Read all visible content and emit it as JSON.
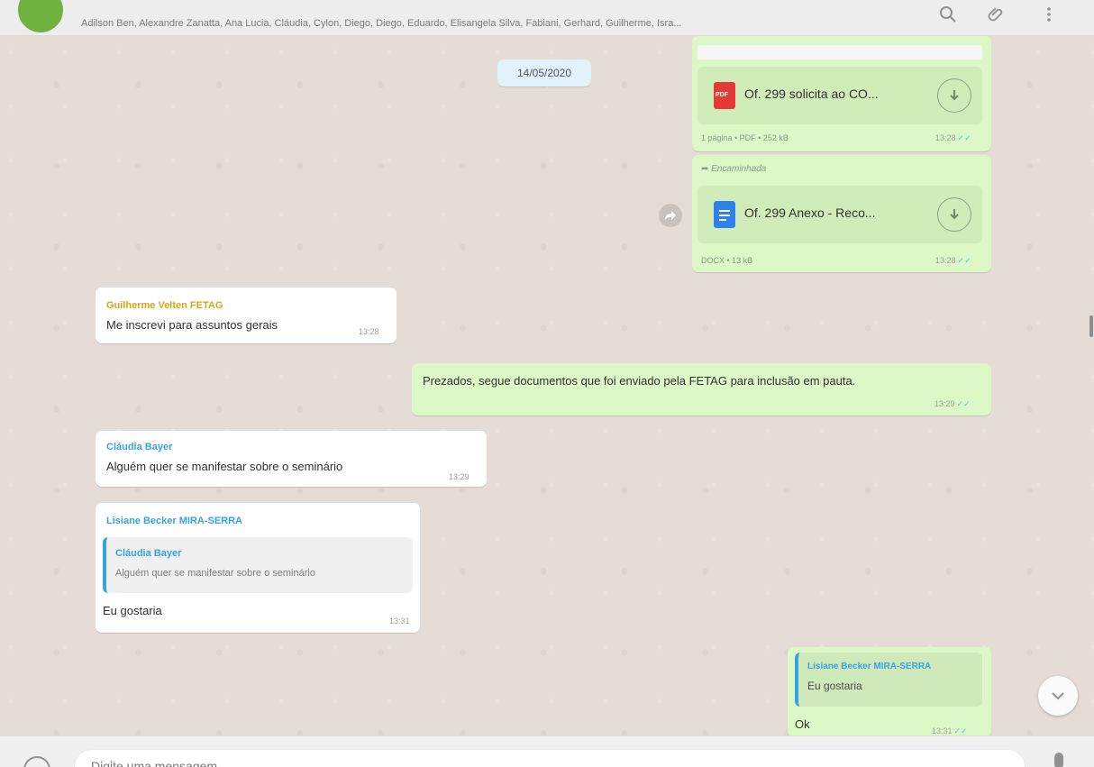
{
  "header": {
    "participants": "Adilson Ben, Alexandre Zanatta, Ana Lucia, Cláudia, Cylon, Diego, Diego, Eduardo, Elisangela Silva, Fabiani, Gerhard, Guilherme, Isra..."
  },
  "chat": {
    "date_chip": "14/05/2020",
    "doc1": {
      "name": "Of. 299 solicita ao CO...",
      "meta": "1 página • PDF • 252 kB",
      "time": "13:28",
      "ticks": "✓✓",
      "type_label": "PDF"
    },
    "doc2": {
      "forwarded": "Encaminhada",
      "name": "Of. 299 Anexo - Reco...",
      "meta": "DOCX • 13 kB",
      "time": "13:28",
      "ticks": "✓✓"
    },
    "msg1": {
      "sender": "Guilherme Velten FETAG",
      "text": "Me inscrevi para assuntos gerais",
      "time": "13:28"
    },
    "msg2": {
      "text": "Prezados, segue documentos que foi enviado pela FETAG para inclusão em pauta.",
      "time": "13:29",
      "ticks": "✓✓"
    },
    "msg3": {
      "sender": "Cláudia Bayer",
      "text": "Alguém quer se manifestar sobre o seminário",
      "time": "13:29"
    },
    "msg4": {
      "sender": "Lisiane Becker MIRA-SERRA",
      "quote_sender": "Cláudia Bayer",
      "quote_text": "Alguém quer se manifestar sobre o seminário",
      "text": "Eu gostaria",
      "time": "13:31"
    },
    "msg5": {
      "quote_sender": "Lisiane Becker MIRA-SERRA",
      "quote_text": "Eu gostaria",
      "text": "Ok",
      "time": "13:31",
      "ticks": "✓✓"
    }
  },
  "footer": {
    "placeholder": "Digite uma mensagem"
  },
  "colors": {
    "incoming_bubble": "#ffffff",
    "outgoing_bubble": "#dcf8c6",
    "sender_guilherme": "#d4a51c",
    "sender_claudia": "#35a3e0",
    "read_ticks": "#4fc3f7"
  }
}
